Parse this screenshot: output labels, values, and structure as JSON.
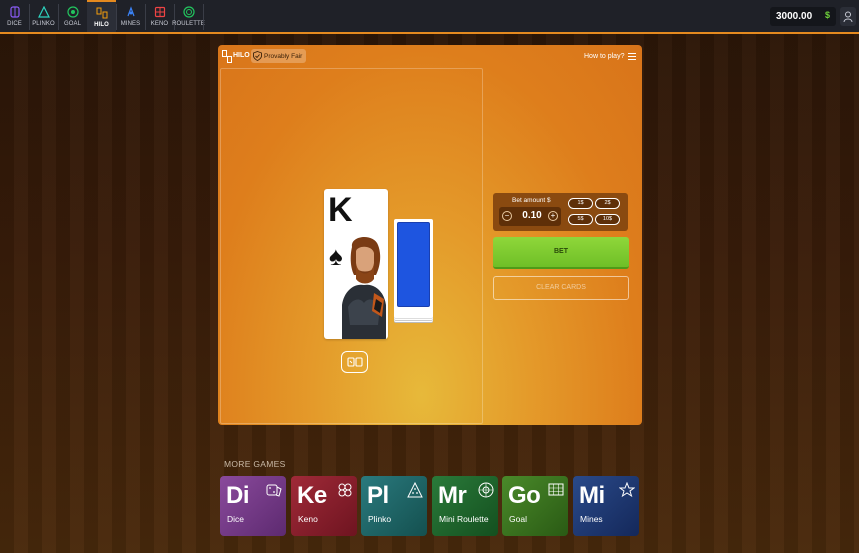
{
  "nav": {
    "items": [
      {
        "label": "DICE",
        "icon": "dice-icon",
        "color": "#8b5cf6",
        "active": false
      },
      {
        "label": "PLINKO",
        "icon": "plinko-icon",
        "color": "#2dd4bf",
        "active": false
      },
      {
        "label": "GOAL",
        "icon": "goal-icon",
        "color": "#22c55e",
        "active": false
      },
      {
        "label": "HILO",
        "icon": "hilo-icon",
        "color": "#f59e0b",
        "active": true
      },
      {
        "label": "MINES",
        "icon": "mines-icon",
        "color": "#3b82f6",
        "active": false
      },
      {
        "label": "KENO",
        "icon": "keno-icon",
        "color": "#ef4444",
        "active": false
      },
      {
        "label": "ROULETTE",
        "icon": "roulette-icon",
        "color": "#22c55e",
        "active": false
      }
    ],
    "balance": "3000.00",
    "currency": "$",
    "accent": "#e58a1f"
  },
  "game": {
    "title": "HILO",
    "provably_fair": "Provably Fair",
    "how_to_play": "How to play?",
    "card": {
      "rank": "K",
      "suit": "♠"
    },
    "bet_amount_label": "Bet amount $",
    "bet_value": "0.10",
    "minus": "−",
    "plus": "+",
    "multipliers": [
      "1$",
      "2$",
      "5$",
      "10$"
    ],
    "bet_button": "BET",
    "clear_button": "CLEAR CARDS"
  },
  "more_games": {
    "title": "MORE GAMES",
    "tiles": [
      {
        "abbr": "Di",
        "name": "Dice",
        "icon": "dice-icon",
        "color": "#7a3a8c"
      },
      {
        "abbr": "Ke",
        "name": "Keno",
        "icon": "keno-icon",
        "color": "#8c1f2c"
      },
      {
        "abbr": "Pl",
        "name": "Plinko",
        "icon": "plinko-icon",
        "color": "#1e6a6e"
      },
      {
        "abbr": "Mr",
        "name": "Mini Roulette",
        "icon": "roulette-icon",
        "color": "#1f6a2e"
      },
      {
        "abbr": "Go",
        "name": "Goal",
        "icon": "goal-icon",
        "color": "#3c7a1f"
      },
      {
        "abbr": "Mi",
        "name": "Mines",
        "icon": "mines-icon",
        "color": "#1f3f7a"
      }
    ]
  }
}
